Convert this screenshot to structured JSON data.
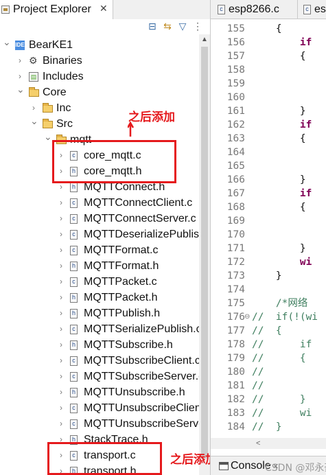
{
  "project_explorer": {
    "tab_title": "Project Explorer",
    "tab_close": "✕",
    "project": "BearKE1",
    "tree": [
      {
        "label": "BearKE1",
        "level": 0,
        "expanded": true,
        "icon": "project"
      },
      {
        "label": "Binaries",
        "level": 1,
        "expanded": false,
        "icon": "binaries"
      },
      {
        "label": "Includes",
        "level": 1,
        "expanded": false,
        "icon": "includes"
      },
      {
        "label": "Core",
        "level": 1,
        "expanded": true,
        "icon": "source-folder"
      },
      {
        "label": "Inc",
        "level": 2,
        "expanded": false,
        "icon": "folder"
      },
      {
        "label": "Src",
        "level": 2,
        "expanded": true,
        "icon": "folder"
      },
      {
        "label": "mqtt",
        "level": 3,
        "expanded": true,
        "icon": "folder"
      },
      {
        "label": "core_mqtt.c",
        "level": 4,
        "expanded": false,
        "icon": "c-file"
      },
      {
        "label": "core_mqtt.h",
        "level": 4,
        "expanded": false,
        "icon": "h-file"
      },
      {
        "label": "MQTTConnect.h",
        "level": 4,
        "expanded": false,
        "icon": "h-file"
      },
      {
        "label": "MQTTConnectClient.c",
        "level": 4,
        "expanded": false,
        "icon": "c-file"
      },
      {
        "label": "MQTTConnectServer.c",
        "level": 4,
        "expanded": false,
        "icon": "c-file"
      },
      {
        "label": "MQTTDeserializePublish.c",
        "level": 4,
        "expanded": false,
        "icon": "c-file"
      },
      {
        "label": "MQTTFormat.c",
        "level": 4,
        "expanded": false,
        "icon": "c-file"
      },
      {
        "label": "MQTTFormat.h",
        "level": 4,
        "expanded": false,
        "icon": "h-file"
      },
      {
        "label": "MQTTPacket.c",
        "level": 4,
        "expanded": false,
        "icon": "c-file"
      },
      {
        "label": "MQTTPacket.h",
        "level": 4,
        "expanded": false,
        "icon": "h-file"
      },
      {
        "label": "MQTTPublish.h",
        "level": 4,
        "expanded": false,
        "icon": "h-file"
      },
      {
        "label": "MQTTSerializePublish.c",
        "level": 4,
        "expanded": false,
        "icon": "c-file"
      },
      {
        "label": "MQTTSubscribe.h",
        "level": 4,
        "expanded": false,
        "icon": "h-file"
      },
      {
        "label": "MQTTSubscribeClient.c",
        "level": 4,
        "expanded": false,
        "icon": "c-file"
      },
      {
        "label": "MQTTSubscribeServer.c",
        "level": 4,
        "expanded": false,
        "icon": "c-file"
      },
      {
        "label": "MQTTUnsubscribe.h",
        "level": 4,
        "expanded": false,
        "icon": "h-file"
      },
      {
        "label": "MQTTUnsubscribeClient.c",
        "level": 4,
        "expanded": false,
        "icon": "c-file"
      },
      {
        "label": "MQTTUnsubscribeServer.c",
        "level": 4,
        "expanded": false,
        "icon": "c-file"
      },
      {
        "label": "StackTrace.h",
        "level": 4,
        "expanded": false,
        "icon": "h-file"
      },
      {
        "label": "transport.c",
        "level": 4,
        "expanded": false,
        "icon": "c-file"
      },
      {
        "label": "transport.h",
        "level": 4,
        "expanded": false,
        "icon": "h-file"
      }
    ],
    "annotation_text": "之后添加",
    "annotation_color": "#e5191c"
  },
  "editor": {
    "tabs": [
      "esp8266.c",
      "esp"
    ],
    "lines": [
      {
        "num": "155",
        "text": "    {"
      },
      {
        "num": "156",
        "text": "        if"
      },
      {
        "num": "157",
        "text": "        {"
      },
      {
        "num": "158",
        "text": ""
      },
      {
        "num": "159",
        "text": ""
      },
      {
        "num": "160",
        "text": ""
      },
      {
        "num": "161",
        "text": "        }"
      },
      {
        "num": "162",
        "text": "        if"
      },
      {
        "num": "163",
        "text": "        {"
      },
      {
        "num": "164",
        "text": ""
      },
      {
        "num": "165",
        "text": ""
      },
      {
        "num": "166",
        "text": "        }"
      },
      {
        "num": "167",
        "text": "        if"
      },
      {
        "num": "168",
        "text": "        {"
      },
      {
        "num": "169",
        "text": ""
      },
      {
        "num": "170",
        "text": ""
      },
      {
        "num": "171",
        "text": "        }"
      },
      {
        "num": "172",
        "text": "        wi"
      },
      {
        "num": "173",
        "text": "    }"
      },
      {
        "num": "174",
        "text": ""
      },
      {
        "num": "175",
        "text": "    /*网络"
      },
      {
        "num": "176",
        "text": "//  if(!(wi"
      },
      {
        "num": "177",
        "text": "//  {"
      },
      {
        "num": "178",
        "text": "//      if"
      },
      {
        "num": "179",
        "text": "//      {"
      },
      {
        "num": "180",
        "text": "//"
      },
      {
        "num": "181",
        "text": "//"
      },
      {
        "num": "182",
        "text": "//      }"
      },
      {
        "num": "183",
        "text": "//      wi"
      },
      {
        "num": "184",
        "text": "//  }"
      }
    ]
  },
  "console": {
    "label": "Console",
    "close": "✕",
    "watermark": "CSDN @邓永豪"
  },
  "colors": {
    "keyword": "#7f0055",
    "comment": "#3f7f5f",
    "annotation": "#e5191c"
  }
}
